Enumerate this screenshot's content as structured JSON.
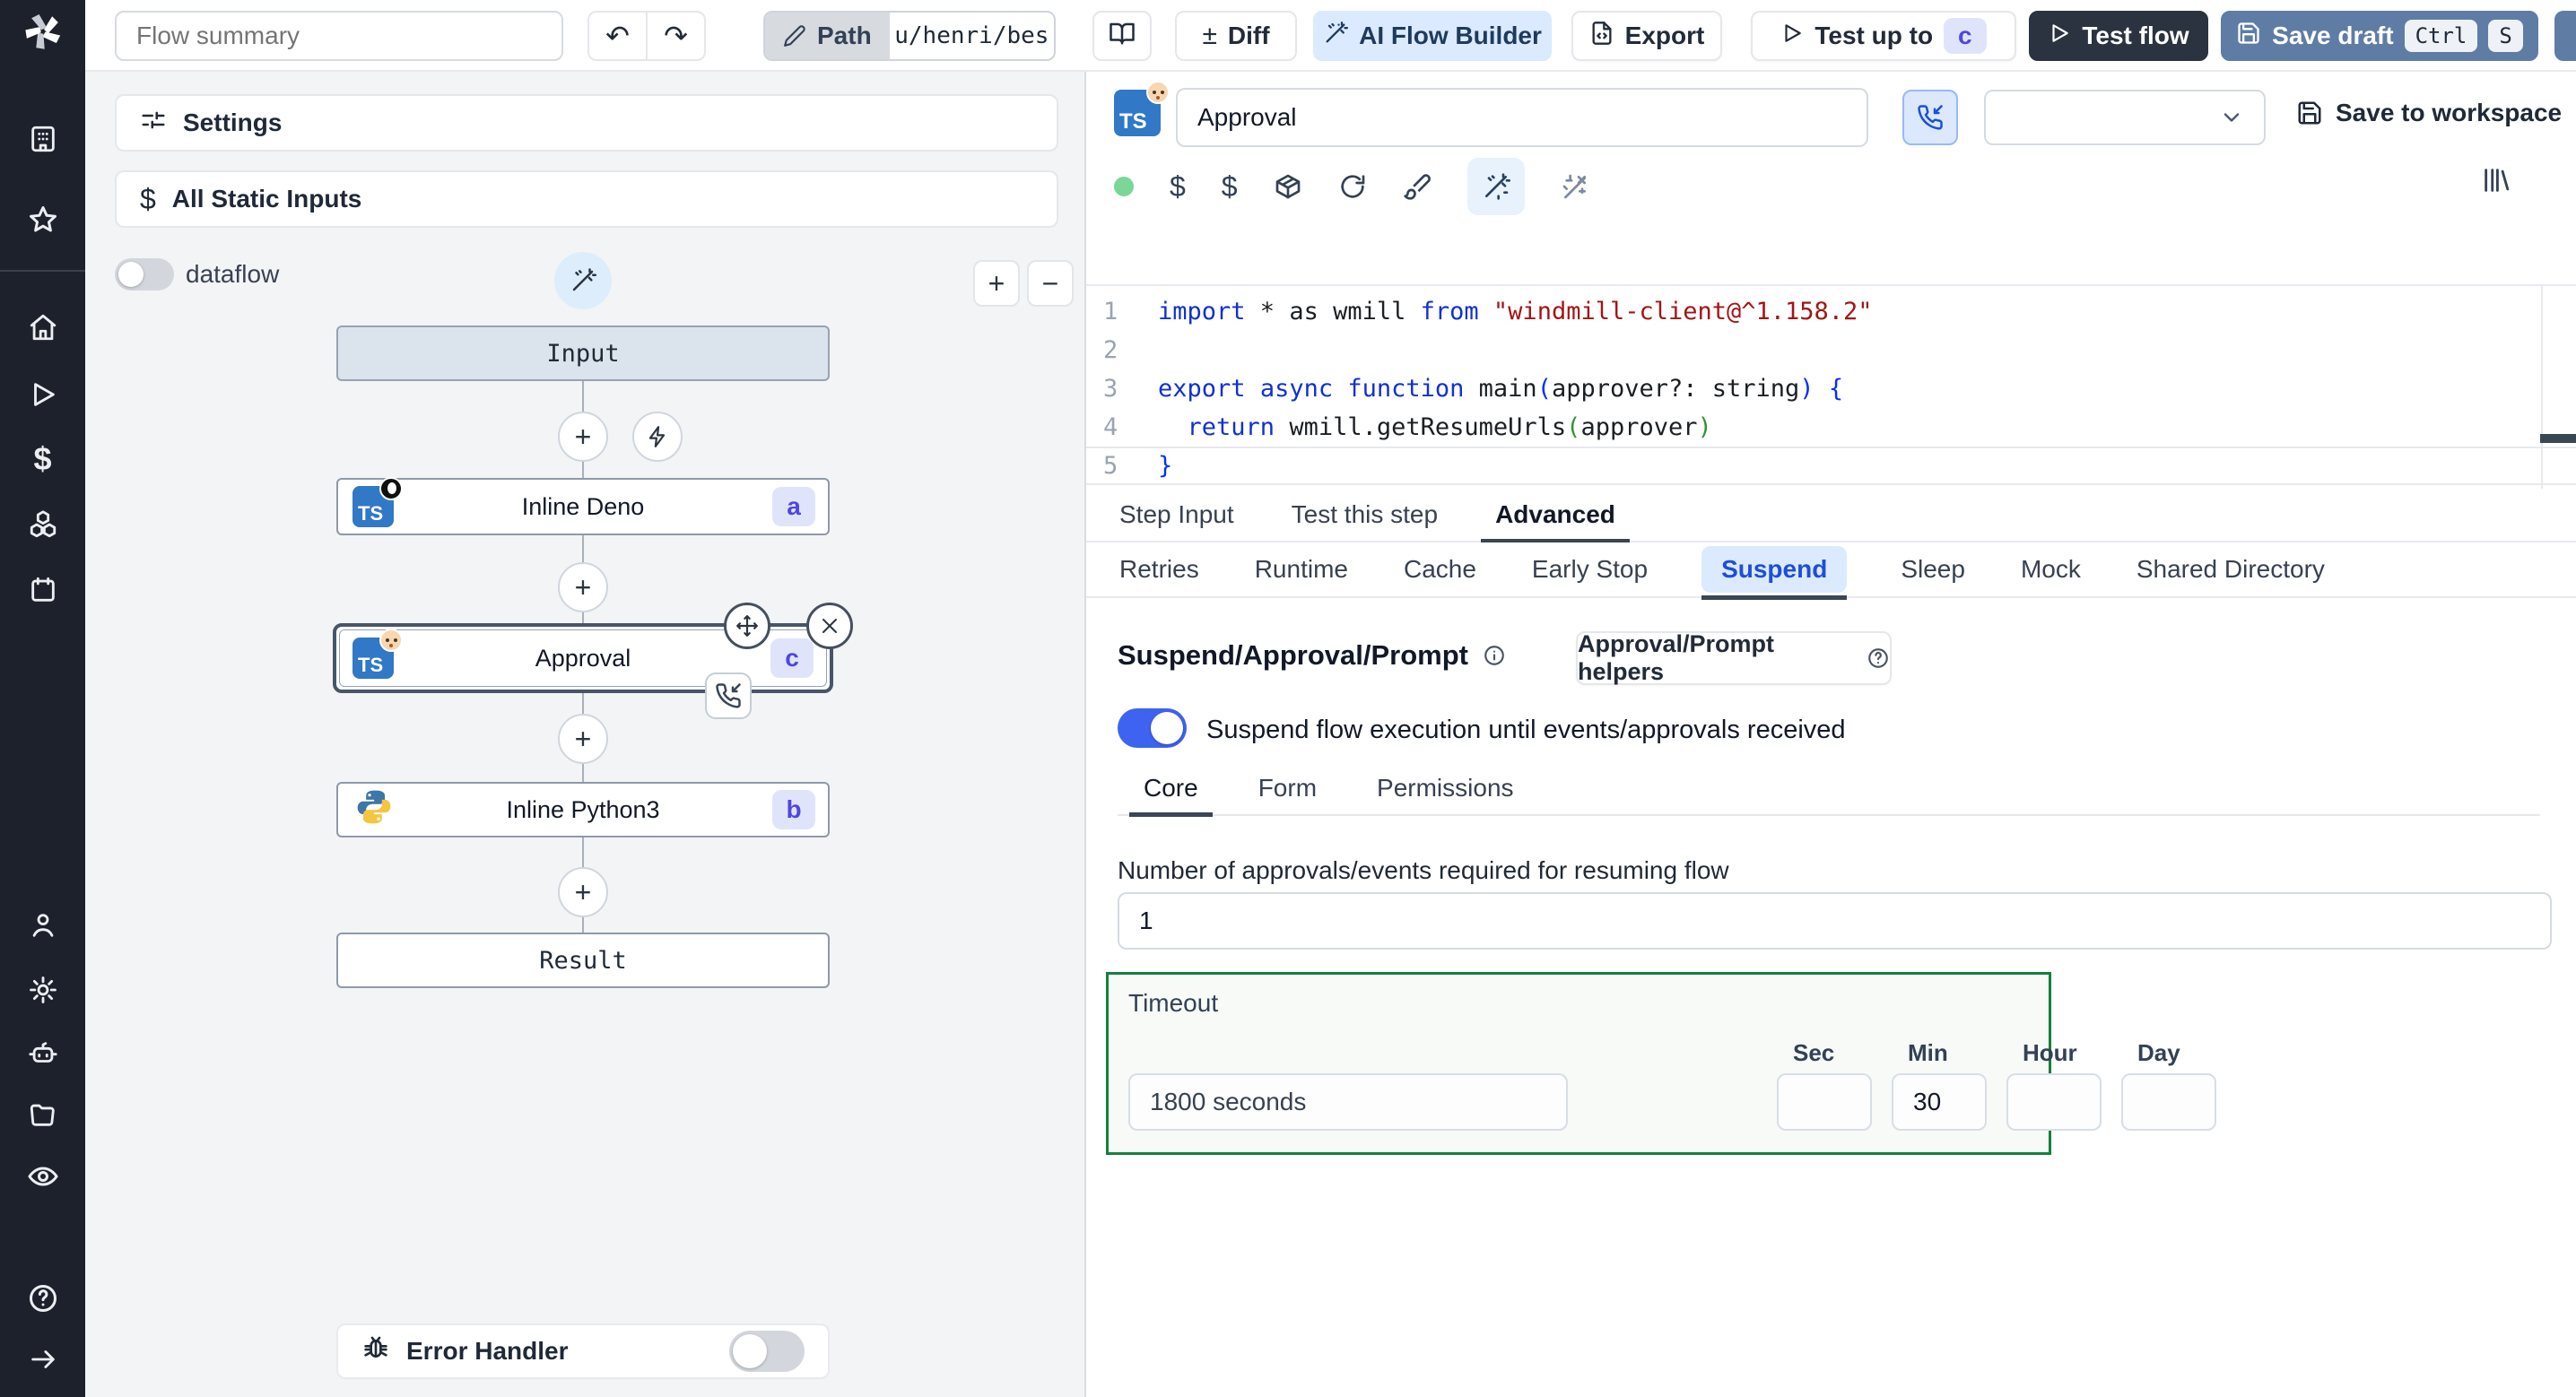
{
  "icons": {
    "diff_glyph": "±",
    "undo_glyph": "↶",
    "redo_glyph": "↷",
    "plus_glyph": "+",
    "minus_glyph": "−",
    "dollar_glyph": "$"
  },
  "topbar": {
    "flow_summary_placeholder": "Flow summary",
    "path_label": "Path",
    "path_value": "u/henri/bes",
    "diff_label": "Diff",
    "ai_flow_builder_label": "AI Flow Builder",
    "export_label": "Export",
    "test_up_to_label": "Test up to",
    "test_up_to_badge": "c",
    "test_flow_label": "Test flow",
    "save_draft_label": "Save draft",
    "kbd_ctrl": "Ctrl",
    "kbd_s": "S"
  },
  "left_panel": {
    "settings_label": "Settings",
    "all_static_inputs_label": "All Static Inputs",
    "dataflow_label": "dataflow",
    "graph": {
      "input_label": "Input",
      "nodes": [
        {
          "label": "Inline Deno",
          "badge": "a"
        },
        {
          "label": "Approval",
          "badge": "c"
        },
        {
          "label": "Inline Python3",
          "badge": "b"
        }
      ],
      "result_label": "Result"
    },
    "error_handler_label": "Error Handler"
  },
  "editor": {
    "step_name": "Approval",
    "save_to_workspace_label": "Save to workspace",
    "active_line": 5,
    "code_lines": [
      {
        "num": "1",
        "tokens": [
          {
            "c": "kw",
            "t": "import"
          },
          {
            "c": "pl",
            "t": " * as wmill "
          },
          {
            "c": "kw",
            "t": "from"
          },
          {
            "c": "pl",
            "t": " "
          },
          {
            "c": "str",
            "t": "\"windmill-client@^1.158.2\""
          }
        ]
      },
      {
        "num": "2",
        "tokens": []
      },
      {
        "num": "3",
        "tokens": [
          {
            "c": "kw",
            "t": "export"
          },
          {
            "c": "pl",
            "t": " "
          },
          {
            "c": "kw",
            "t": "async"
          },
          {
            "c": "pl",
            "t": " "
          },
          {
            "c": "kw",
            "t": "function"
          },
          {
            "c": "pl",
            "t": " main"
          },
          {
            "c": "bb",
            "t": "("
          },
          {
            "c": "pl",
            "t": "approver?: string"
          },
          {
            "c": "bb",
            "t": ")"
          },
          {
            "c": "pl",
            "t": " "
          },
          {
            "c": "bb",
            "t": "{"
          }
        ]
      },
      {
        "num": "4",
        "tokens": [
          {
            "c": "pl",
            "t": "  "
          },
          {
            "c": "kw",
            "t": "return"
          },
          {
            "c": "pl",
            "t": " wmill.getResumeUrls"
          },
          {
            "c": "bg",
            "t": "("
          },
          {
            "c": "pl",
            "t": "approver"
          },
          {
            "c": "bg",
            "t": ")"
          }
        ]
      },
      {
        "num": "5",
        "tokens": [
          {
            "c": "bb",
            "t": "}"
          }
        ]
      }
    ]
  },
  "step_tabs": [
    "Step Input",
    "Test this step",
    "Advanced"
  ],
  "advanced_tabs": [
    "Retries",
    "Runtime",
    "Cache",
    "Early Stop",
    "Suspend",
    "Sleep",
    "Mock",
    "Shared Directory"
  ],
  "suspend": {
    "title": "Suspend/Approval/Prompt",
    "helpers_label": "Approval/Prompt helpers",
    "toggle_label": "Suspend flow execution until events/approvals received",
    "tabs": [
      "Core",
      "Form",
      "Permissions"
    ],
    "approvals_label": "Number of approvals/events required for resuming flow",
    "approvals_value": "1",
    "timeout": {
      "label": "Timeout",
      "display_value": "1800 seconds",
      "units": [
        "Sec",
        "Min",
        "Hour",
        "Day"
      ],
      "sec_value": "",
      "min_value": "30",
      "hour_value": "",
      "day_value": ""
    }
  },
  "colors": {
    "accent_blue": "#2f62ea",
    "toggle_on": "#3e63f0",
    "timeout_border": "#15803d",
    "badge_bg": "#e0e4fb",
    "badge_text": "#4f46e5",
    "save_draft_bg": "#5f7da4",
    "test_flow_bg": "#2b3340"
  }
}
